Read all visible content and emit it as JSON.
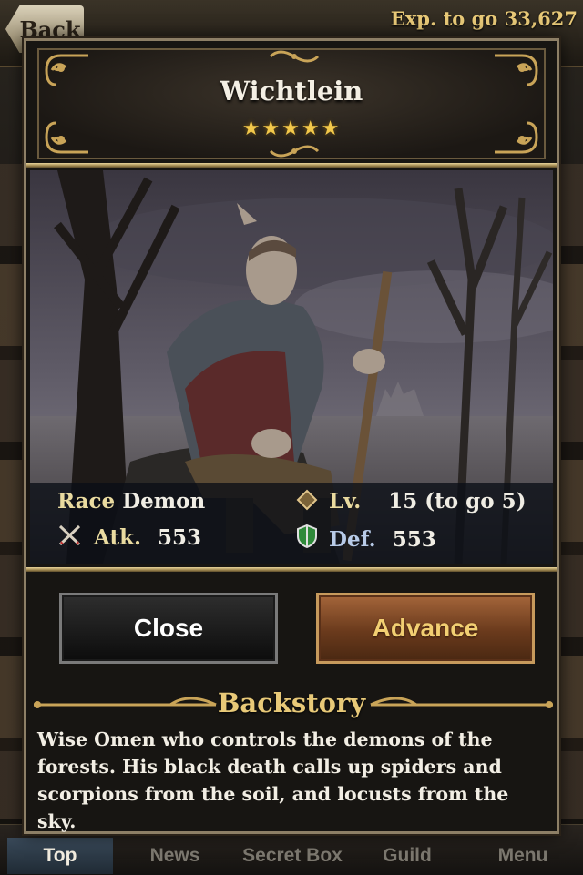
{
  "header": {
    "back_label": "Back",
    "exp_text": "Exp. to go 33,627"
  },
  "card": {
    "name": "Wichtlein",
    "stars": "★★★★★",
    "rarity": 5
  },
  "stats": {
    "race_label": "Race",
    "race_value": "Demon",
    "level_label": "Lv.",
    "level_value": "15",
    "level_to_go": "(to go 5)",
    "atk_label": "Atk.",
    "atk_value": "553",
    "def_label": "Def.",
    "def_value": "553"
  },
  "actions": {
    "close_label": "Close",
    "advance_label": "Advance"
  },
  "backstory": {
    "title": "Backstory",
    "text": "Wise Omen who controls the demons of the forests. His black death calls up spiders and scorpions from the soil, and locusts from the sky."
  },
  "nav": {
    "items": [
      {
        "label": "Top"
      },
      {
        "label": "News"
      },
      {
        "label": "Secret Box"
      },
      {
        "label": "Guild"
      },
      {
        "label": "Menu"
      }
    ]
  },
  "colors": {
    "gold": "#e8c978",
    "star": "#f2c84b",
    "advance_bg": "#8a4e28",
    "close_bg": "#1a1a1a"
  }
}
